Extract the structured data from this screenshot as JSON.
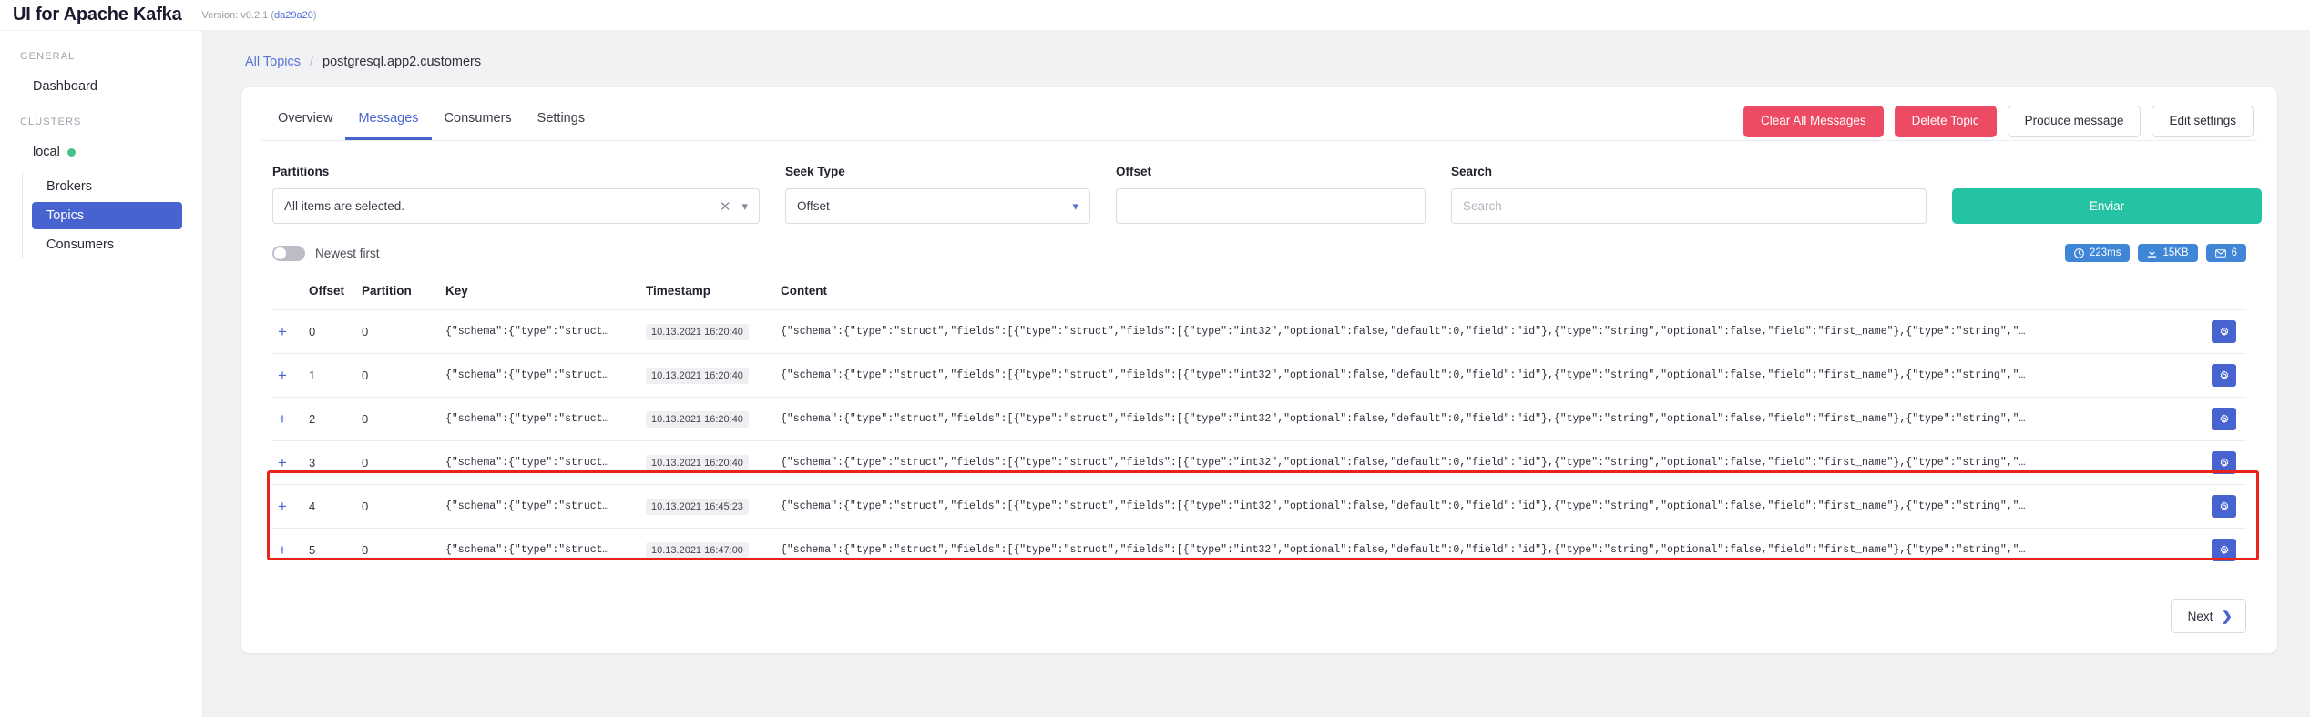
{
  "topbar": {
    "brand": "UI for Apache Kafka",
    "version_label": "Version: v0.2.1 (",
    "version_sha": "da29a20",
    "version_close": ")"
  },
  "sidebar": {
    "general_title": "GENERAL",
    "dashboard_label": "Dashboard",
    "clusters_title": "CLUSTERS",
    "cluster_name": "local",
    "cluster_status_color": "#4ac28d",
    "sub_items": [
      {
        "label": "Brokers",
        "active": false
      },
      {
        "label": "Topics",
        "active": true
      },
      {
        "label": "Consumers",
        "active": false
      }
    ]
  },
  "breadcrumb": {
    "root": "All Topics",
    "separator": "/",
    "current": "postgresql.app2.customers"
  },
  "tabs": [
    {
      "label": "Overview",
      "active": false
    },
    {
      "label": "Messages",
      "active": true
    },
    {
      "label": "Consumers",
      "active": false
    },
    {
      "label": "Settings",
      "active": false
    }
  ],
  "actions": {
    "clear_all": "Clear All Messages",
    "delete_topic": "Delete Topic",
    "produce_message": "Produce message",
    "edit_settings": "Edit settings",
    "danger_color": "#ec4b63"
  },
  "filters": {
    "partitions_label": "Partitions",
    "partitions_value": "All items are selected.",
    "seek_type_label": "Seek Type",
    "seek_type_value": "Offset",
    "offset_label": "Offset",
    "offset_value": "",
    "search_label": "Search",
    "search_placeholder": "Search",
    "submit_label": "Enviar",
    "submit_color": "#24c3a3"
  },
  "toggle": {
    "newest_first_label": "Newest first",
    "newest_first_on": false
  },
  "badges": [
    {
      "icon": "clock-icon",
      "text": "223ms"
    },
    {
      "icon": "download-icon",
      "text": "15KB"
    },
    {
      "icon": "envelope-icon",
      "text": "6"
    }
  ],
  "table": {
    "headers": [
      "",
      "Offset",
      "Partition",
      "Key",
      "Timestamp",
      "Content",
      ""
    ],
    "key_preview": "{\"schema\":{\"type\":\"struct…",
    "content_preview": "{\"schema\":{\"type\":\"struct\",\"fields\":[{\"type\":\"struct\",\"fields\":[{\"type\":\"int32\",\"optional\":false,\"default\":0,\"field\":\"id\"},{\"type\":\"string\",\"optional\":false,\"field\":\"first_name\"},{\"type\":\"string\",\"…",
    "rows": [
      {
        "offset": "0",
        "partition": "0",
        "timestamp": "10.13.2021 16:20:40",
        "highlighted": false
      },
      {
        "offset": "1",
        "partition": "0",
        "timestamp": "10.13.2021 16:20:40",
        "highlighted": false
      },
      {
        "offset": "2",
        "partition": "0",
        "timestamp": "10.13.2021 16:20:40",
        "highlighted": false
      },
      {
        "offset": "3",
        "partition": "0",
        "timestamp": "10.13.2021 16:20:40",
        "highlighted": false
      },
      {
        "offset": "4",
        "partition": "0",
        "timestamp": "10.13.2021 16:45:23",
        "highlighted": true
      },
      {
        "offset": "5",
        "partition": "0",
        "timestamp": "10.13.2021 16:47:00",
        "highlighted": true
      }
    ]
  },
  "pagination": {
    "next_label": "Next",
    "next_arrow": "❯"
  },
  "highlight": {
    "color": "#e8241a"
  }
}
